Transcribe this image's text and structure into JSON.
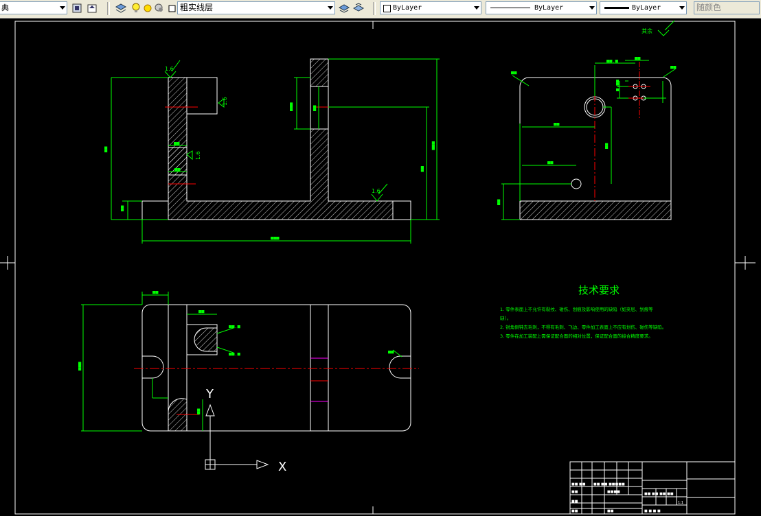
{
  "toolbar": {
    "style_fragment": "典",
    "layer_name": "粗实线层",
    "color_control": "ByLayer",
    "linetype_control": "ByLayer",
    "lineweight_control": "ByLayer",
    "plotstyle_control": "随颜色"
  },
  "drawing": {
    "surface_mark_1": "1.6",
    "surface_mark_2": "1.6",
    "surface_mark_3": "1.6",
    "surface_mark_4": "1.6",
    "remaining_mark": "其余",
    "tech_title": "技术要求",
    "tech_lines": [
      "1. 零件表面上不允许有裂纹、碰伤、划痕及影响使用的缺陷（如夹层、划痕等",
      "缺）。",
      "2. 锐角倒钝去毛刺，不得有毛刺、飞边、零件加工表面上不应有划伤、碰伤等缺陷。",
      "3. 零件在加工装配上需保证配合面的相对位置，保证配合面的接合精度要求。"
    ],
    "ucs_y": "Y",
    "ucs_x": "X",
    "title_block_fragment": "1:1"
  },
  "colors": {
    "background": "#000000",
    "geometry": "#ffffff",
    "dimension": "#00ff00",
    "centerline": "#ff0000",
    "hatch": "#ffffff",
    "magenta": "#ff00ff"
  }
}
